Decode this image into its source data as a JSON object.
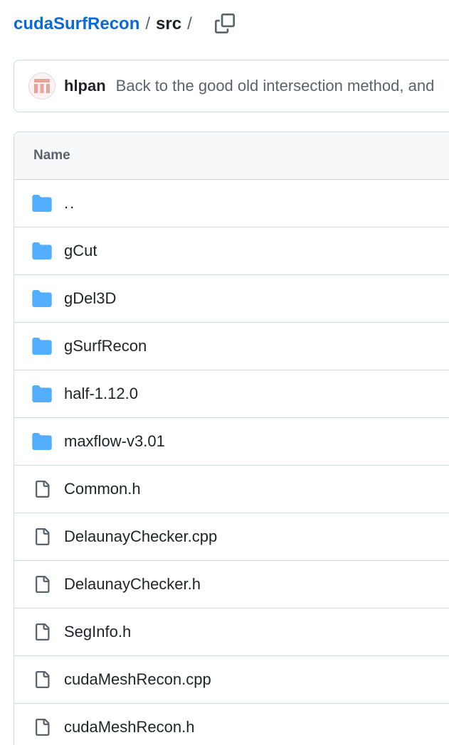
{
  "breadcrumb": {
    "repo": "cudaSurfRecon",
    "sep1": "/",
    "dir": "src",
    "sep2": "/"
  },
  "commit": {
    "author": "hlpan",
    "message": "Back to the good old intersection method, and"
  },
  "table": {
    "header_name": "Name",
    "rows": [
      {
        "name": "..",
        "type": "folder",
        "icon": "folder-icon"
      },
      {
        "name": "gCut",
        "type": "folder",
        "icon": "folder-icon"
      },
      {
        "name": "gDel3D",
        "type": "folder",
        "icon": "folder-icon"
      },
      {
        "name": "gSurfRecon",
        "type": "folder",
        "icon": "folder-icon"
      },
      {
        "name": "half-1.12.0",
        "type": "folder",
        "icon": "folder-icon"
      },
      {
        "name": "maxflow-v3.01",
        "type": "folder",
        "icon": "folder-icon"
      },
      {
        "name": "Common.h",
        "type": "file",
        "icon": "file-icon"
      },
      {
        "name": "DelaunayChecker.cpp",
        "type": "file",
        "icon": "file-icon"
      },
      {
        "name": "DelaunayChecker.h",
        "type": "file",
        "icon": "file-icon"
      },
      {
        "name": "SegInfo.h",
        "type": "file",
        "icon": "file-icon"
      },
      {
        "name": "cudaMeshRecon.cpp",
        "type": "file",
        "icon": "file-icon"
      },
      {
        "name": "cudaMeshRecon.h",
        "type": "file",
        "icon": "file-icon"
      }
    ]
  },
  "colors": {
    "link": "#0969da",
    "folder": "#54aeff",
    "file_icon": "#59636e",
    "border": "#d1d9e0",
    "header_bg": "#f6f8fa"
  }
}
